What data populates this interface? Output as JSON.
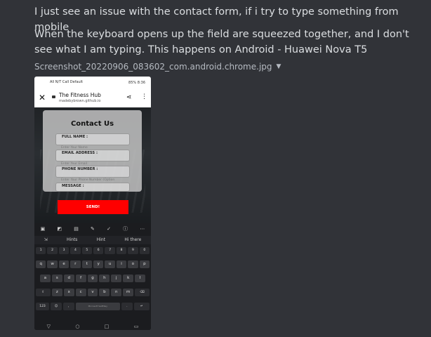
{
  "messages": [
    "I just see an issue with the contact form, if i try to type something from mobile",
    "When the keyboard opens up the field are squeezed together, and I don't see what I am typing. This happens on Android - Huawei Nova T5"
  ],
  "attachment": {
    "filename": "Screenshot_20220906_083602_com.android.chrome.jpg"
  },
  "phone": {
    "status": {
      "carrier": "All N/T Call Default",
      "battery": "85%",
      "time": "8:36"
    },
    "browser": {
      "title": "The Fitness Hub",
      "url": "madebybrown.github.io"
    },
    "form": {
      "title": "Contact Us",
      "fields": [
        {
          "label": "FULL NAME :",
          "placeholder": "Enter Your Name"
        },
        {
          "label": "EMAIL ADDRESS :",
          "placeholder": "Enter Your Email"
        },
        {
          "label": "PHONE NUMBER :",
          "placeholder": "Enter Your Phone Number (Option"
        },
        {
          "label": "MESSAGE :",
          "placeholder": ""
        }
      ],
      "send_label": "SEND!"
    },
    "keyboard": {
      "hints": [
        "Hints",
        "Hint",
        "Hi there"
      ],
      "numbers": [
        "1",
        "2",
        "3",
        "4",
        "5",
        "6",
        "7",
        "8",
        "9",
        "0"
      ],
      "row1": [
        "q",
        "w",
        "e",
        "r",
        "t",
        "y",
        "u",
        "i",
        "o",
        "p"
      ],
      "row2": [
        "a",
        "s",
        "d",
        "f",
        "g",
        "h",
        "j",
        "k",
        "l"
      ],
      "row3": [
        "z",
        "x",
        "c",
        "v",
        "b",
        "n",
        "m"
      ],
      "bottom": {
        "symbols": "123",
        "space": "Microsoft SwiftKey"
      }
    }
  }
}
